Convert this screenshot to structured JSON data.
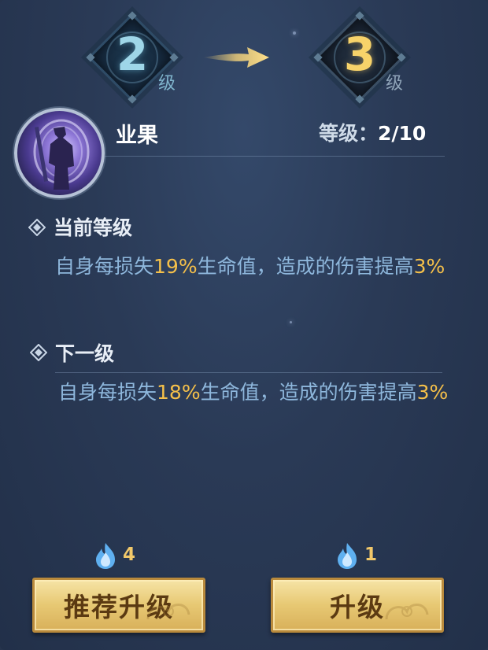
{
  "level_transition": {
    "current_level": "2",
    "next_level": "3",
    "unit": "级"
  },
  "skill": {
    "name": "业果",
    "level_label": "等级：",
    "level_value": "2/10"
  },
  "current_section": {
    "title": "当前等级",
    "desc_before": "自身每损失",
    "desc_percent": "19%",
    "desc_middle": "生命值，造成的伤害提高",
    "desc_bonus": "3%"
  },
  "next_section": {
    "title": "下一级",
    "desc_before": "自身每损失",
    "desc_percent": "18%",
    "desc_middle": "生命值，造成的伤害提高",
    "desc_bonus": "3%"
  },
  "actions": {
    "recommend": {
      "cost": "4",
      "label": "推荐升级",
      "cost_icon": "blue-flame-icon"
    },
    "upgrade": {
      "cost": "1",
      "label": "升级",
      "cost_icon": "blue-flame-icon"
    }
  },
  "colors": {
    "highlight": "#f5c04a",
    "description": "#8eb7dc",
    "current_level_number": "#9ed6e8",
    "next_level_number": "#f7d36a",
    "button_gold": "#e7c873"
  }
}
